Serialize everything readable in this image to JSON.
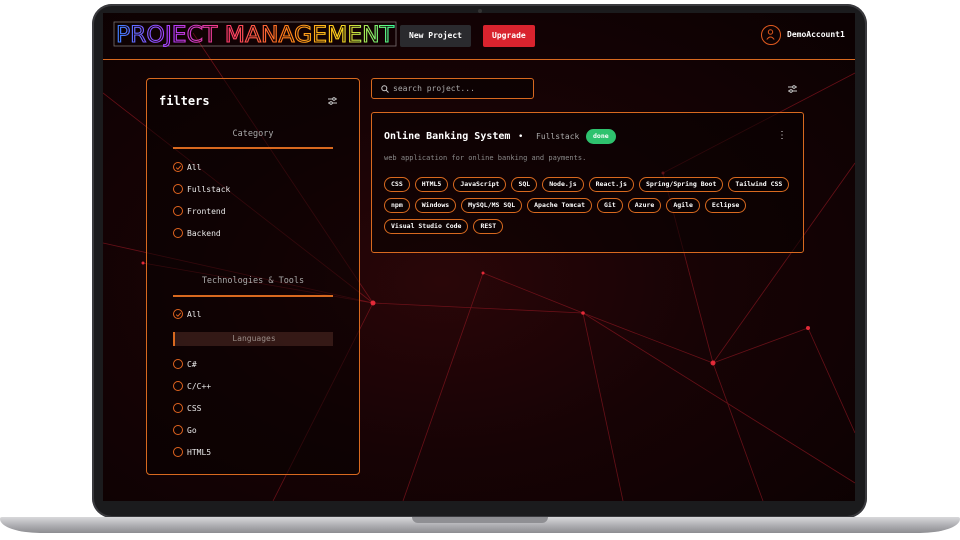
{
  "app": {
    "title": "PROJECT MANAGEMENT",
    "buttons": {
      "new_project": "New Project",
      "upgrade": "Upgrade"
    },
    "account": {
      "name": "DemoAccount1",
      "icon": "user-icon"
    }
  },
  "filters": {
    "title": "filters",
    "category": {
      "title": "Category",
      "options": [
        {
          "label": "All",
          "checked": true
        },
        {
          "label": "Fullstack",
          "checked": false
        },
        {
          "label": "Frontend",
          "checked": false
        },
        {
          "label": "Backend",
          "checked": false
        }
      ]
    },
    "technologies": {
      "title": "Technologies & Tools",
      "all_label": "All",
      "languages_header": "Languages",
      "languages": [
        "C#",
        "C/C++",
        "CSS",
        "Go",
        "HTML5"
      ]
    }
  },
  "search": {
    "placeholder": "search project..."
  },
  "project": {
    "title": "Online Banking System",
    "separator": "•",
    "category": "Fullstack",
    "status": "done",
    "description": "web application for online banking and payments.",
    "tags": [
      "CSS",
      "HTML5",
      "JavaScript",
      "SQL",
      "Node.js",
      "React.js",
      "Spring/Spring Boot",
      "Tailwind CSS",
      "npm",
      "Windows",
      "MySQL/MS SQL",
      "Apache Tomcat",
      "Git",
      "Azure",
      "Agile",
      "Eclipse",
      "Visual Studio Code",
      "REST"
    ]
  },
  "colors": {
    "accent": "#d8691f",
    "upgrade": "#d9232e",
    "status_done": "#2ec26e",
    "background": "#0b0102"
  }
}
